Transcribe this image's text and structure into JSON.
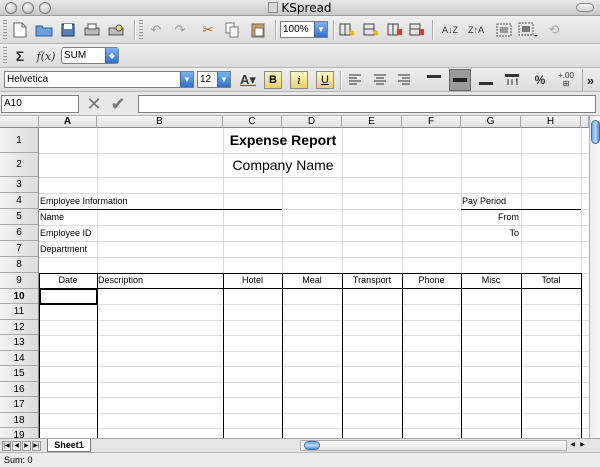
{
  "window": {
    "title": "KSpread"
  },
  "toolbar": {
    "zoom": "100%",
    "function_label": "f(x)",
    "function_select": "SUM",
    "sum_symbol": "Σ",
    "font_family": "Helvetica",
    "font_size": "12",
    "bold": "B",
    "italic": "i",
    "underline": "U",
    "percent": "%",
    "increase_precision": "+.00",
    "more": "»"
  },
  "editline": {
    "cell_ref": "A10",
    "formula": ""
  },
  "columns": [
    "A",
    "B",
    "C",
    "D",
    "E",
    "F",
    "G",
    "H"
  ],
  "rows": [
    "1",
    "2",
    "3",
    "4",
    "5",
    "6",
    "7",
    "8",
    "9",
    "10",
    "11",
    "12",
    "13",
    "14",
    "15",
    "16",
    "17",
    "18",
    "19"
  ],
  "selected_row": "10",
  "sheet": {
    "title": "Expense Report",
    "company": "Company Name",
    "employee_info": "Employee Information",
    "name": "Name",
    "employee_id": "Employee ID",
    "department": "Department",
    "pay_period": "Pay Period",
    "from": "From",
    "to": "To",
    "headers": [
      "Date",
      "Description",
      "Hotel",
      "Meal",
      "Transport",
      "Phone",
      "Misc",
      "Total"
    ]
  },
  "tabs": [
    "Sheet1"
  ],
  "status": "Sum: 0"
}
